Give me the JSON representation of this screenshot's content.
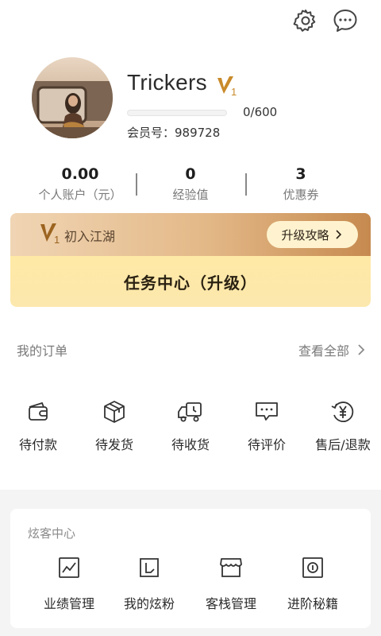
{
  "topbar": {
    "settings_icon": "gear-icon",
    "message_icon": "chat-bubble-icon"
  },
  "profile": {
    "username": "Trickers",
    "level_badge": "V",
    "level_badge_sub": "1",
    "xp_text": "0/600",
    "xp_progress": 0,
    "member_label": "会员号：989728"
  },
  "stats": [
    {
      "value": "0.00",
      "label": "个人账户（元）"
    },
    {
      "value": "0",
      "label": "经验值"
    },
    {
      "value": "3",
      "label": "优惠券"
    }
  ],
  "level_card": {
    "badge": "V",
    "badge_sub": "1",
    "level_name": "初入江湖",
    "upgrade_label": "升级攻略",
    "task_center_label": "任务中心（升级）"
  },
  "orders": {
    "title": "我的订单",
    "view_all": "查看全部",
    "items": [
      {
        "label": "待付款",
        "icon": "wallet-icon"
      },
      {
        "label": "待发货",
        "icon": "package-icon"
      },
      {
        "label": "待收货",
        "icon": "delivery-truck-icon"
      },
      {
        "label": "待评价",
        "icon": "comment-icon"
      },
      {
        "label": "售后/退款",
        "icon": "yen-refund-icon"
      }
    ]
  },
  "xk_center": {
    "title": "炫客中心",
    "items": [
      {
        "label": "业绩管理",
        "icon": "line-chart-icon"
      },
      {
        "label": "我的炫粉",
        "icon": "fans-card-icon"
      },
      {
        "label": "客栈管理",
        "icon": "store-icon"
      },
      {
        "label": "进阶秘籍",
        "icon": "info-book-icon"
      }
    ]
  },
  "colors": {
    "accent_gold": "#d9a25a",
    "task_bg": "#fde9a8",
    "upgrade_btn_bg": "#fff3cf"
  }
}
